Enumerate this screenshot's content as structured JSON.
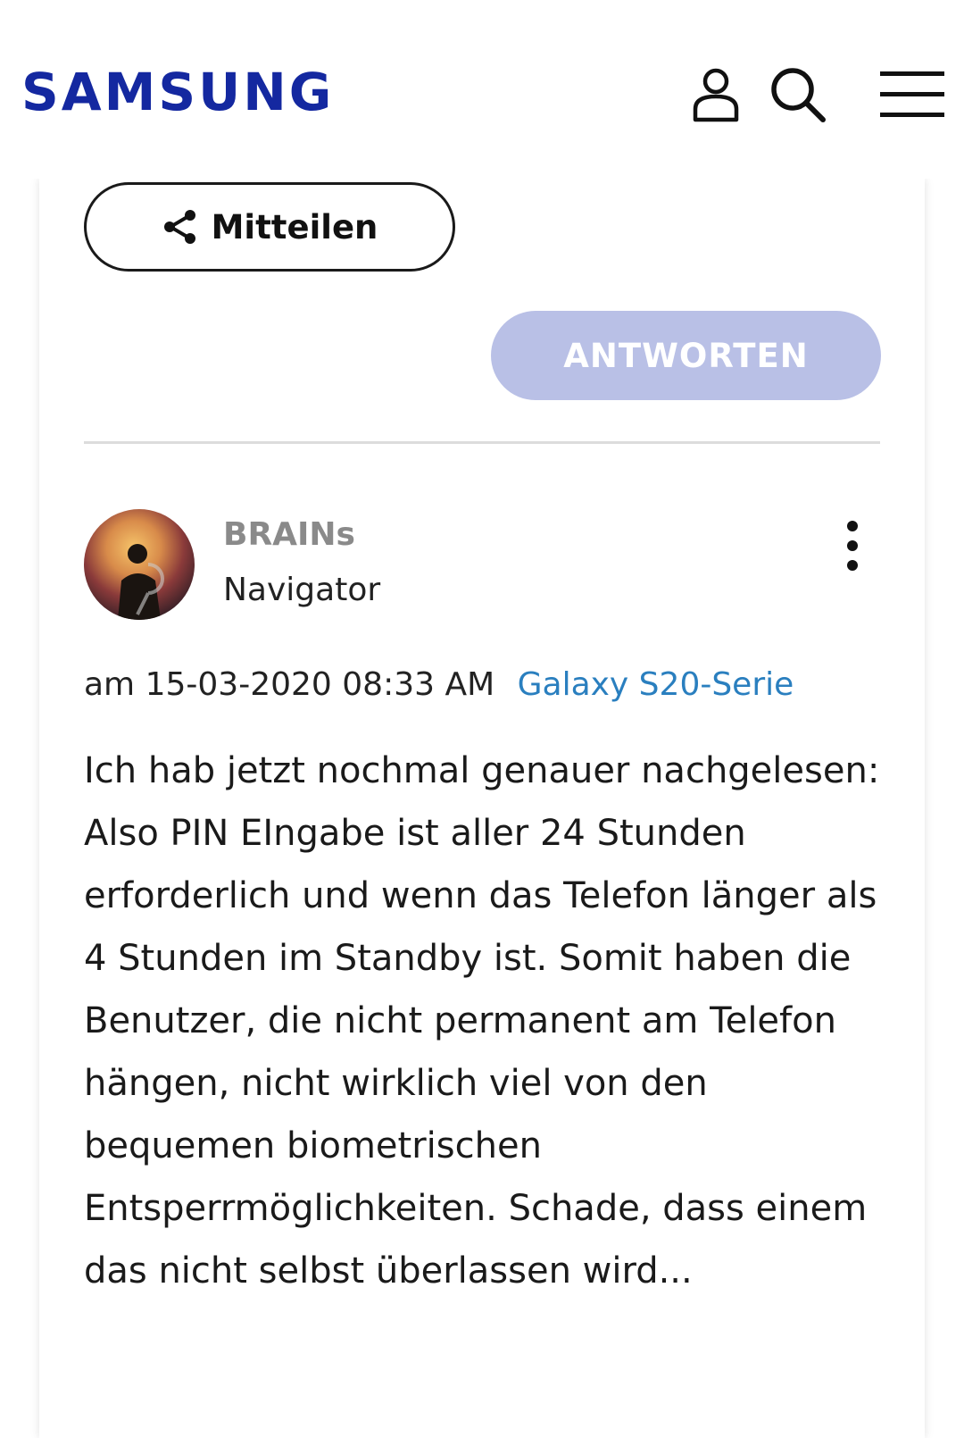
{
  "header": {
    "logo_text": "SAMSUNG",
    "logo_color": "#1428a0",
    "icons": [
      "user-icon",
      "search-icon",
      "hamburger-menu-icon"
    ]
  },
  "post_actions": {
    "share_label": "Mitteilen",
    "reply_label": "ANTWORTEN",
    "reply_color": "#b9c0e6"
  },
  "reply": {
    "author": "BRAINs",
    "rank": "Navigator",
    "date_prefix": "am",
    "date": "15-03-2020",
    "time": "08:33 AM",
    "board": "Galaxy S20-Serie",
    "board_color": "#2a7fbf",
    "body": "Ich hab jetzt nochmal genauer nachgelesen: Also PIN EIngabe ist aller 24 Stunden erforderlich und wenn das Telefon länger als 4 Stunden im Standby ist. Somit haben die Benutzer, die nicht permanent am Telefon hängen, nicht wirklich viel von den bequemen biometrischen Entsperrmöglichkeiten. Schade, dass einem das nicht selbst überlassen wird..."
  }
}
